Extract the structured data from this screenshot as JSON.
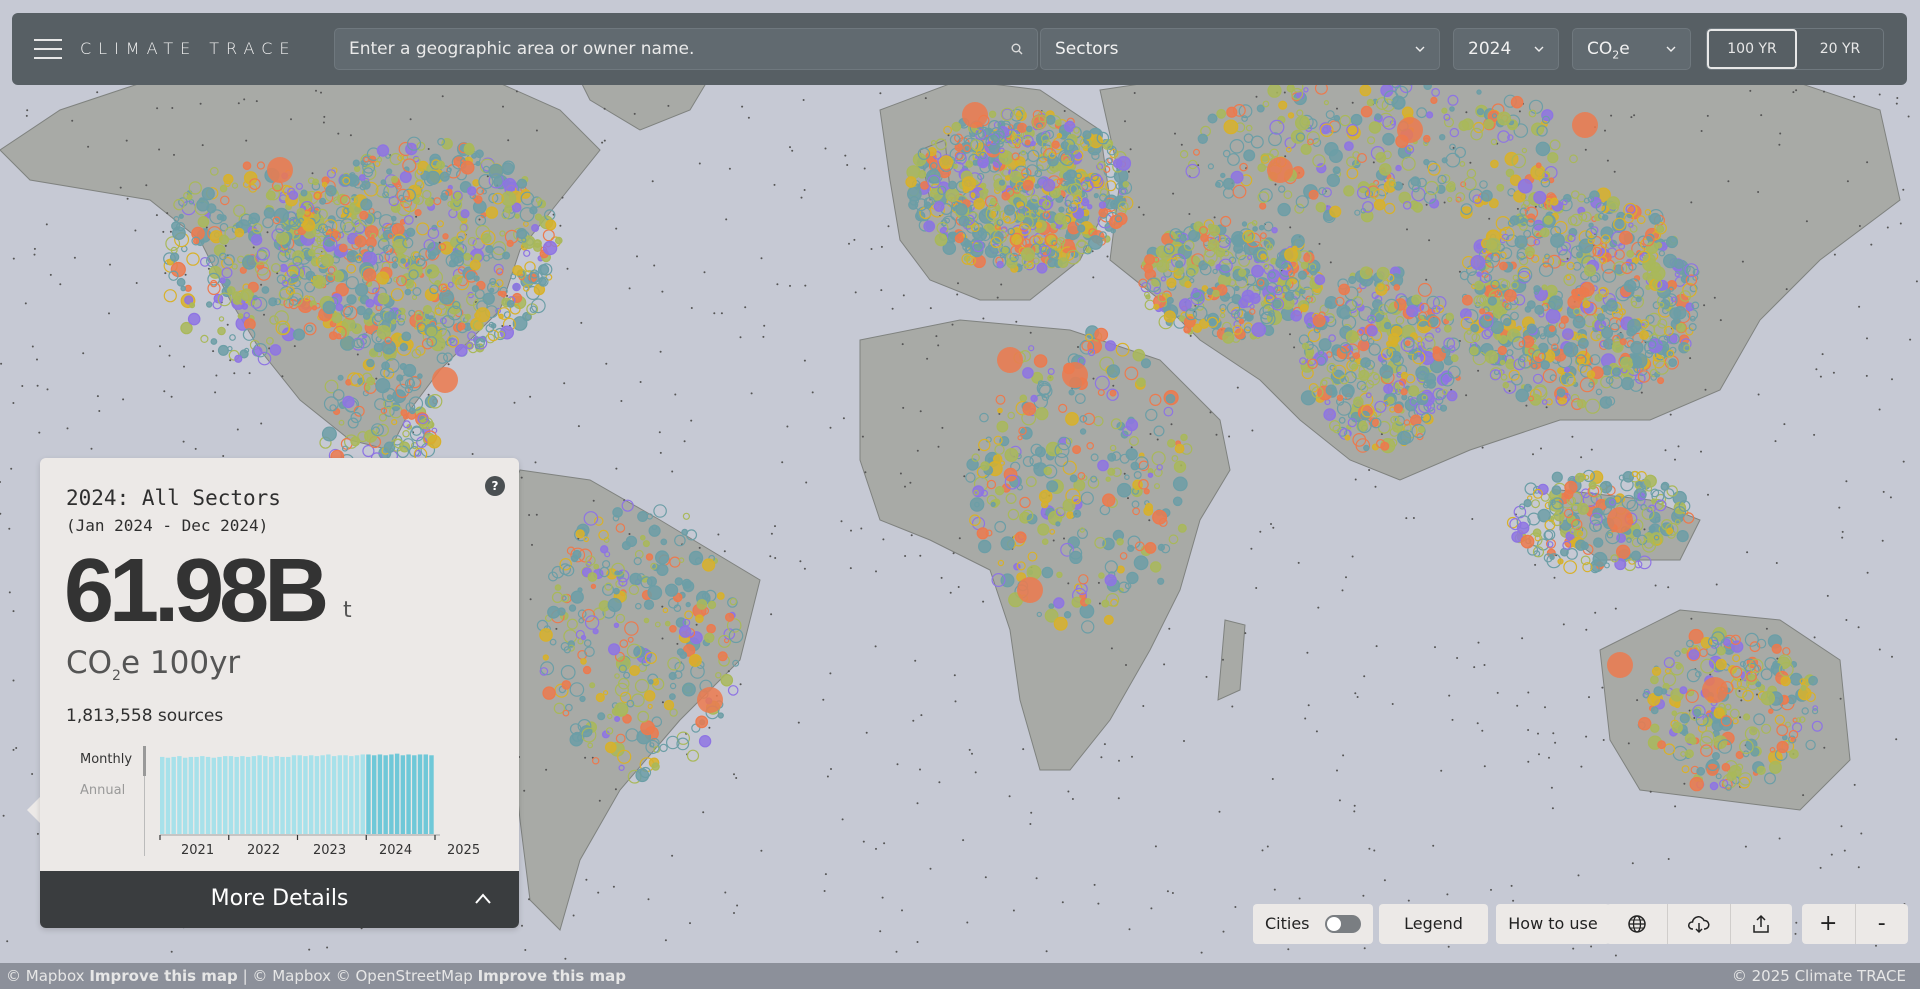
{
  "header": {
    "brand": "CLIMATE TRACE",
    "search_placeholder": "Enter a geographic area or owner name.",
    "sectors_label": "Sectors",
    "year_label": "2024",
    "gas_label": "CO",
    "gas_sub": "2",
    "gas_suffix": "e",
    "gwp_100": "100 YR",
    "gwp_20": "20 YR"
  },
  "summary": {
    "title": "2024: All Sectors",
    "range": "(Jan 2024 - Dec 2024)",
    "total": "61.98B",
    "unit": "t",
    "gas_prefix": "CO",
    "gas_sub": "2",
    "gas_suffix": "e 100yr",
    "sources": "1,813,558 sources",
    "toggle_monthly": "Monthly",
    "toggle_annual": "Annual",
    "years": [
      "2021",
      "2022",
      "2023",
      "2024",
      "2025"
    ],
    "more_details": "More Details"
  },
  "chart_data": {
    "type": "bar",
    "categories": [
      "2021",
      "2022",
      "2023",
      "2024"
    ],
    "series": [
      {
        "values": [
          0.94,
          0.93,
          0.94,
          0.95,
          0.93,
          0.94,
          0.94,
          0.95,
          0.94,
          0.93,
          0.94,
          0.95,
          0.95,
          0.94,
          0.95,
          0.94,
          0.95,
          0.96,
          0.95,
          0.94,
          0.95,
          0.94,
          0.94,
          0.96,
          0.96,
          0.95,
          0.96,
          0.95,
          0.96,
          0.97,
          0.95,
          0.96,
          0.96,
          0.95,
          0.96,
          0.97,
          0.97,
          0.96,
          0.97,
          0.96,
          0.97,
          0.98,
          0.96,
          0.97,
          0.96,
          0.97,
          0.97,
          0.96
        ]
      }
    ],
    "highlight_year": "2024",
    "colors": {
      "bar": "#a7e1ea",
      "bar_highlight": "#6fc8d8"
    }
  },
  "controls": {
    "cities": "Cities",
    "legend": "Legend",
    "how_to_use": "How to use",
    "zoom_in": "+",
    "zoom_out": "-"
  },
  "attribution": {
    "mapbox1": "© Mapbox",
    "improve1": "Improve this map",
    "sep": "|",
    "mapbox2": "© Mapbox © OpenStreetMap",
    "improve2": "Improve this map",
    "copyright": "© 2025 Climate TRACE"
  },
  "colors": {
    "ocean": "#c6c9d4",
    "land": "#a8aaa6",
    "dot_teal": "#6c9ea6",
    "dot_orange": "#ec7a4e",
    "dot_purple": "#8e74e3",
    "dot_olive": "#a9b85a",
    "dot_yellow": "#d8b12a",
    "topbar": "#575f64",
    "card": "#ece9e7"
  }
}
